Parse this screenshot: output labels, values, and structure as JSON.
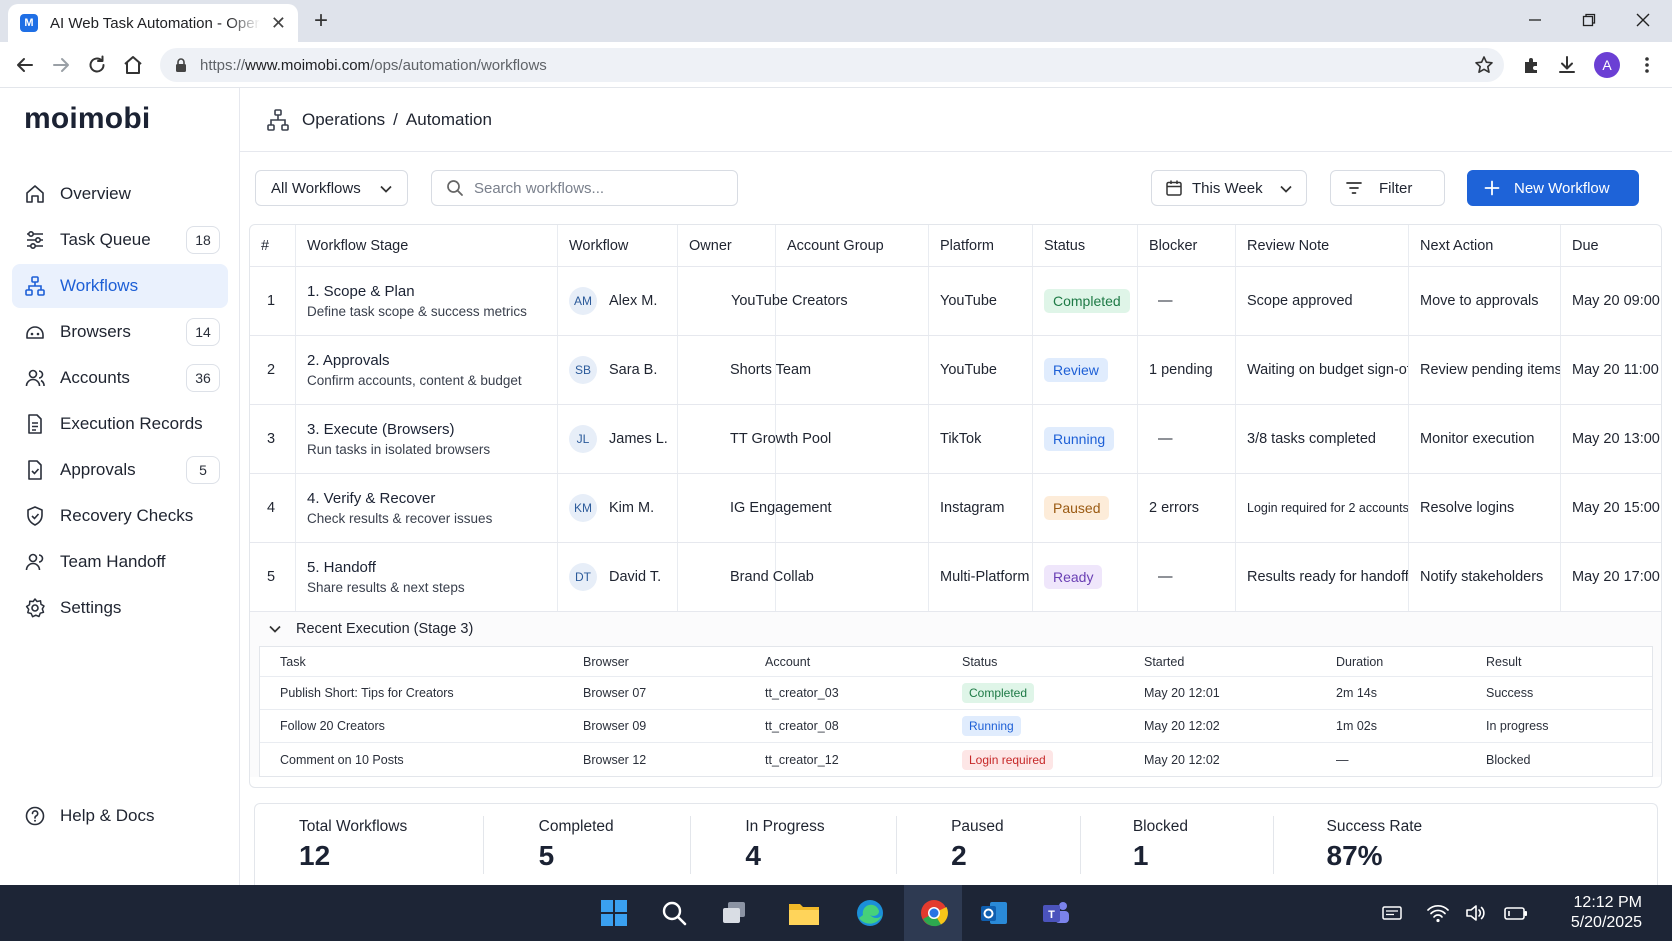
{
  "browser": {
    "tab_title": "AI Web Task Automation - Operations",
    "tab_favicon_letter": "M",
    "url_prefix": "https://",
    "url_host": "www.moimobi.com",
    "url_path": "/ops/automation/workflows",
    "profile_letter": "A"
  },
  "sidebar": {
    "logo": "moimobi",
    "items": [
      {
        "label": "Overview",
        "icon": "home-icon",
        "badge": ""
      },
      {
        "label": "Task Queue",
        "icon": "sliders-icon",
        "badge": "18"
      },
      {
        "label": "Workflows",
        "icon": "workflow-icon",
        "badge": ""
      },
      {
        "label": "Browsers",
        "icon": "browser-icon",
        "badge": "14"
      },
      {
        "label": "Accounts",
        "icon": "users-icon",
        "badge": "36"
      },
      {
        "label": "Execution Records",
        "icon": "document-icon",
        "badge": ""
      },
      {
        "label": "Approvals",
        "icon": "check-document-icon",
        "badge": "5"
      },
      {
        "label": "Recovery Checks",
        "icon": "shield-icon",
        "badge": ""
      },
      {
        "label": "Team Handoff",
        "icon": "team-icon",
        "badge": ""
      },
      {
        "label": "Settings",
        "icon": "gear-icon",
        "badge": ""
      }
    ],
    "help_label": "Help & Docs",
    "active_item": "Workflows"
  },
  "header": {
    "crumb_1": "Operations",
    "separator": "/",
    "crumb_2": "Automation"
  },
  "toolbar": {
    "workflow_select": "All Workflows",
    "search_placeholder": "Search workflows...",
    "date_range": "This Week",
    "filter_label": "Filter",
    "new_workflow_label": "New Workflow"
  },
  "workflows": {
    "columns": [
      "#",
      "Workflow Stage",
      "Workflow",
      "Owner",
      "Account Group",
      "Platform",
      "Status",
      "Blocker",
      "Review Note",
      "Next Action",
      "Due"
    ],
    "rows": [
      {
        "num": "1",
        "stage": "1. Scope & Plan",
        "stage_desc": "Define task scope & success metrics",
        "initials": "AM",
        "owner": "Alex M.",
        "group": "YouTube Creators",
        "platform": "YouTube",
        "status": "Completed",
        "status_key": "completed",
        "blocker": "—",
        "note": "Scope approved",
        "next": "Move to approvals",
        "due": "May 20 09:00"
      },
      {
        "num": "2",
        "stage": "2. Approvals",
        "stage_desc": "Confirm accounts, content & budget",
        "initials": "SB",
        "owner": "Sara B.",
        "group": "Shorts Team",
        "platform": "YouTube",
        "status": "Review",
        "status_key": "review",
        "blocker": "1 pending",
        "note": "Waiting on budget sign-off",
        "next": "Review pending items",
        "due": "May 20 11:00"
      },
      {
        "num": "3",
        "stage": "3. Execute (Browsers)",
        "stage_desc": "Run tasks in isolated browsers",
        "initials": "JL",
        "owner": "James L.",
        "group": "TT Growth Pool",
        "platform": "TikTok",
        "status": "Running",
        "status_key": "running",
        "blocker": "—",
        "note": "3/8 tasks completed",
        "next": "Monitor execution",
        "due": "May 20 13:00"
      },
      {
        "num": "4",
        "stage": "4. Verify & Recover",
        "stage_desc": "Check results & recover issues",
        "initials": "KM",
        "owner": "Kim M.",
        "group": "IG Engagement",
        "platform": "Instagram",
        "status": "Paused",
        "status_key": "paused",
        "blocker": "2 errors",
        "note": "Login required for 2 accounts",
        "next": "Resolve logins",
        "due": "May 20 15:00"
      },
      {
        "num": "5",
        "stage": "5. Handoff",
        "stage_desc": "Share results & next steps",
        "initials": "DT",
        "owner": "David T.",
        "group": "Brand Collab",
        "platform": "Multi-Platform",
        "status": "Ready",
        "status_key": "ready",
        "blocker": "—",
        "note": "Results ready for handoff",
        "next": "Notify stakeholders",
        "due": "May 20 17:00"
      }
    ]
  },
  "execution": {
    "title": "Recent Execution (Stage 3)",
    "columns": [
      "Task",
      "Browser",
      "Account",
      "Status",
      "Started",
      "Duration",
      "Result"
    ],
    "rows": [
      {
        "task": "Publish Short: Tips for Creators",
        "browser": "Browser 07",
        "account": "tt_creator_03",
        "status": "Completed",
        "status_key": "completed",
        "started": "May 20 12:01",
        "duration": "2m 14s",
        "result": "Success"
      },
      {
        "task": "Follow 20 Creators",
        "browser": "Browser 09",
        "account": "tt_creator_08",
        "status": "Running",
        "status_key": "running",
        "started": "May 20 12:02",
        "duration": "1m 02s",
        "result": "In progress"
      },
      {
        "task": "Comment on 10 Posts",
        "browser": "Browser 12",
        "account": "tt_creator_12",
        "status": "Login required",
        "status_key": "login",
        "started": "May 20 12:02",
        "duration": "—",
        "result": "Blocked"
      }
    ]
  },
  "stats": [
    {
      "label": "Total Workflows",
      "value": "12"
    },
    {
      "label": "Completed",
      "value": "5"
    },
    {
      "label": "In Progress",
      "value": "4"
    },
    {
      "label": "Paused",
      "value": "2"
    },
    {
      "label": "Blocked",
      "value": "1"
    },
    {
      "label": "Success Rate",
      "value": "87%"
    }
  ],
  "taskbar": {
    "time": "12:12 PM",
    "date": "5/20/2025"
  },
  "colors": {
    "accent": "#1e63d8",
    "completed": "#1e7a46",
    "paused": "#9a5a12",
    "ready": "#6a3fb4",
    "error": "#c62828"
  }
}
